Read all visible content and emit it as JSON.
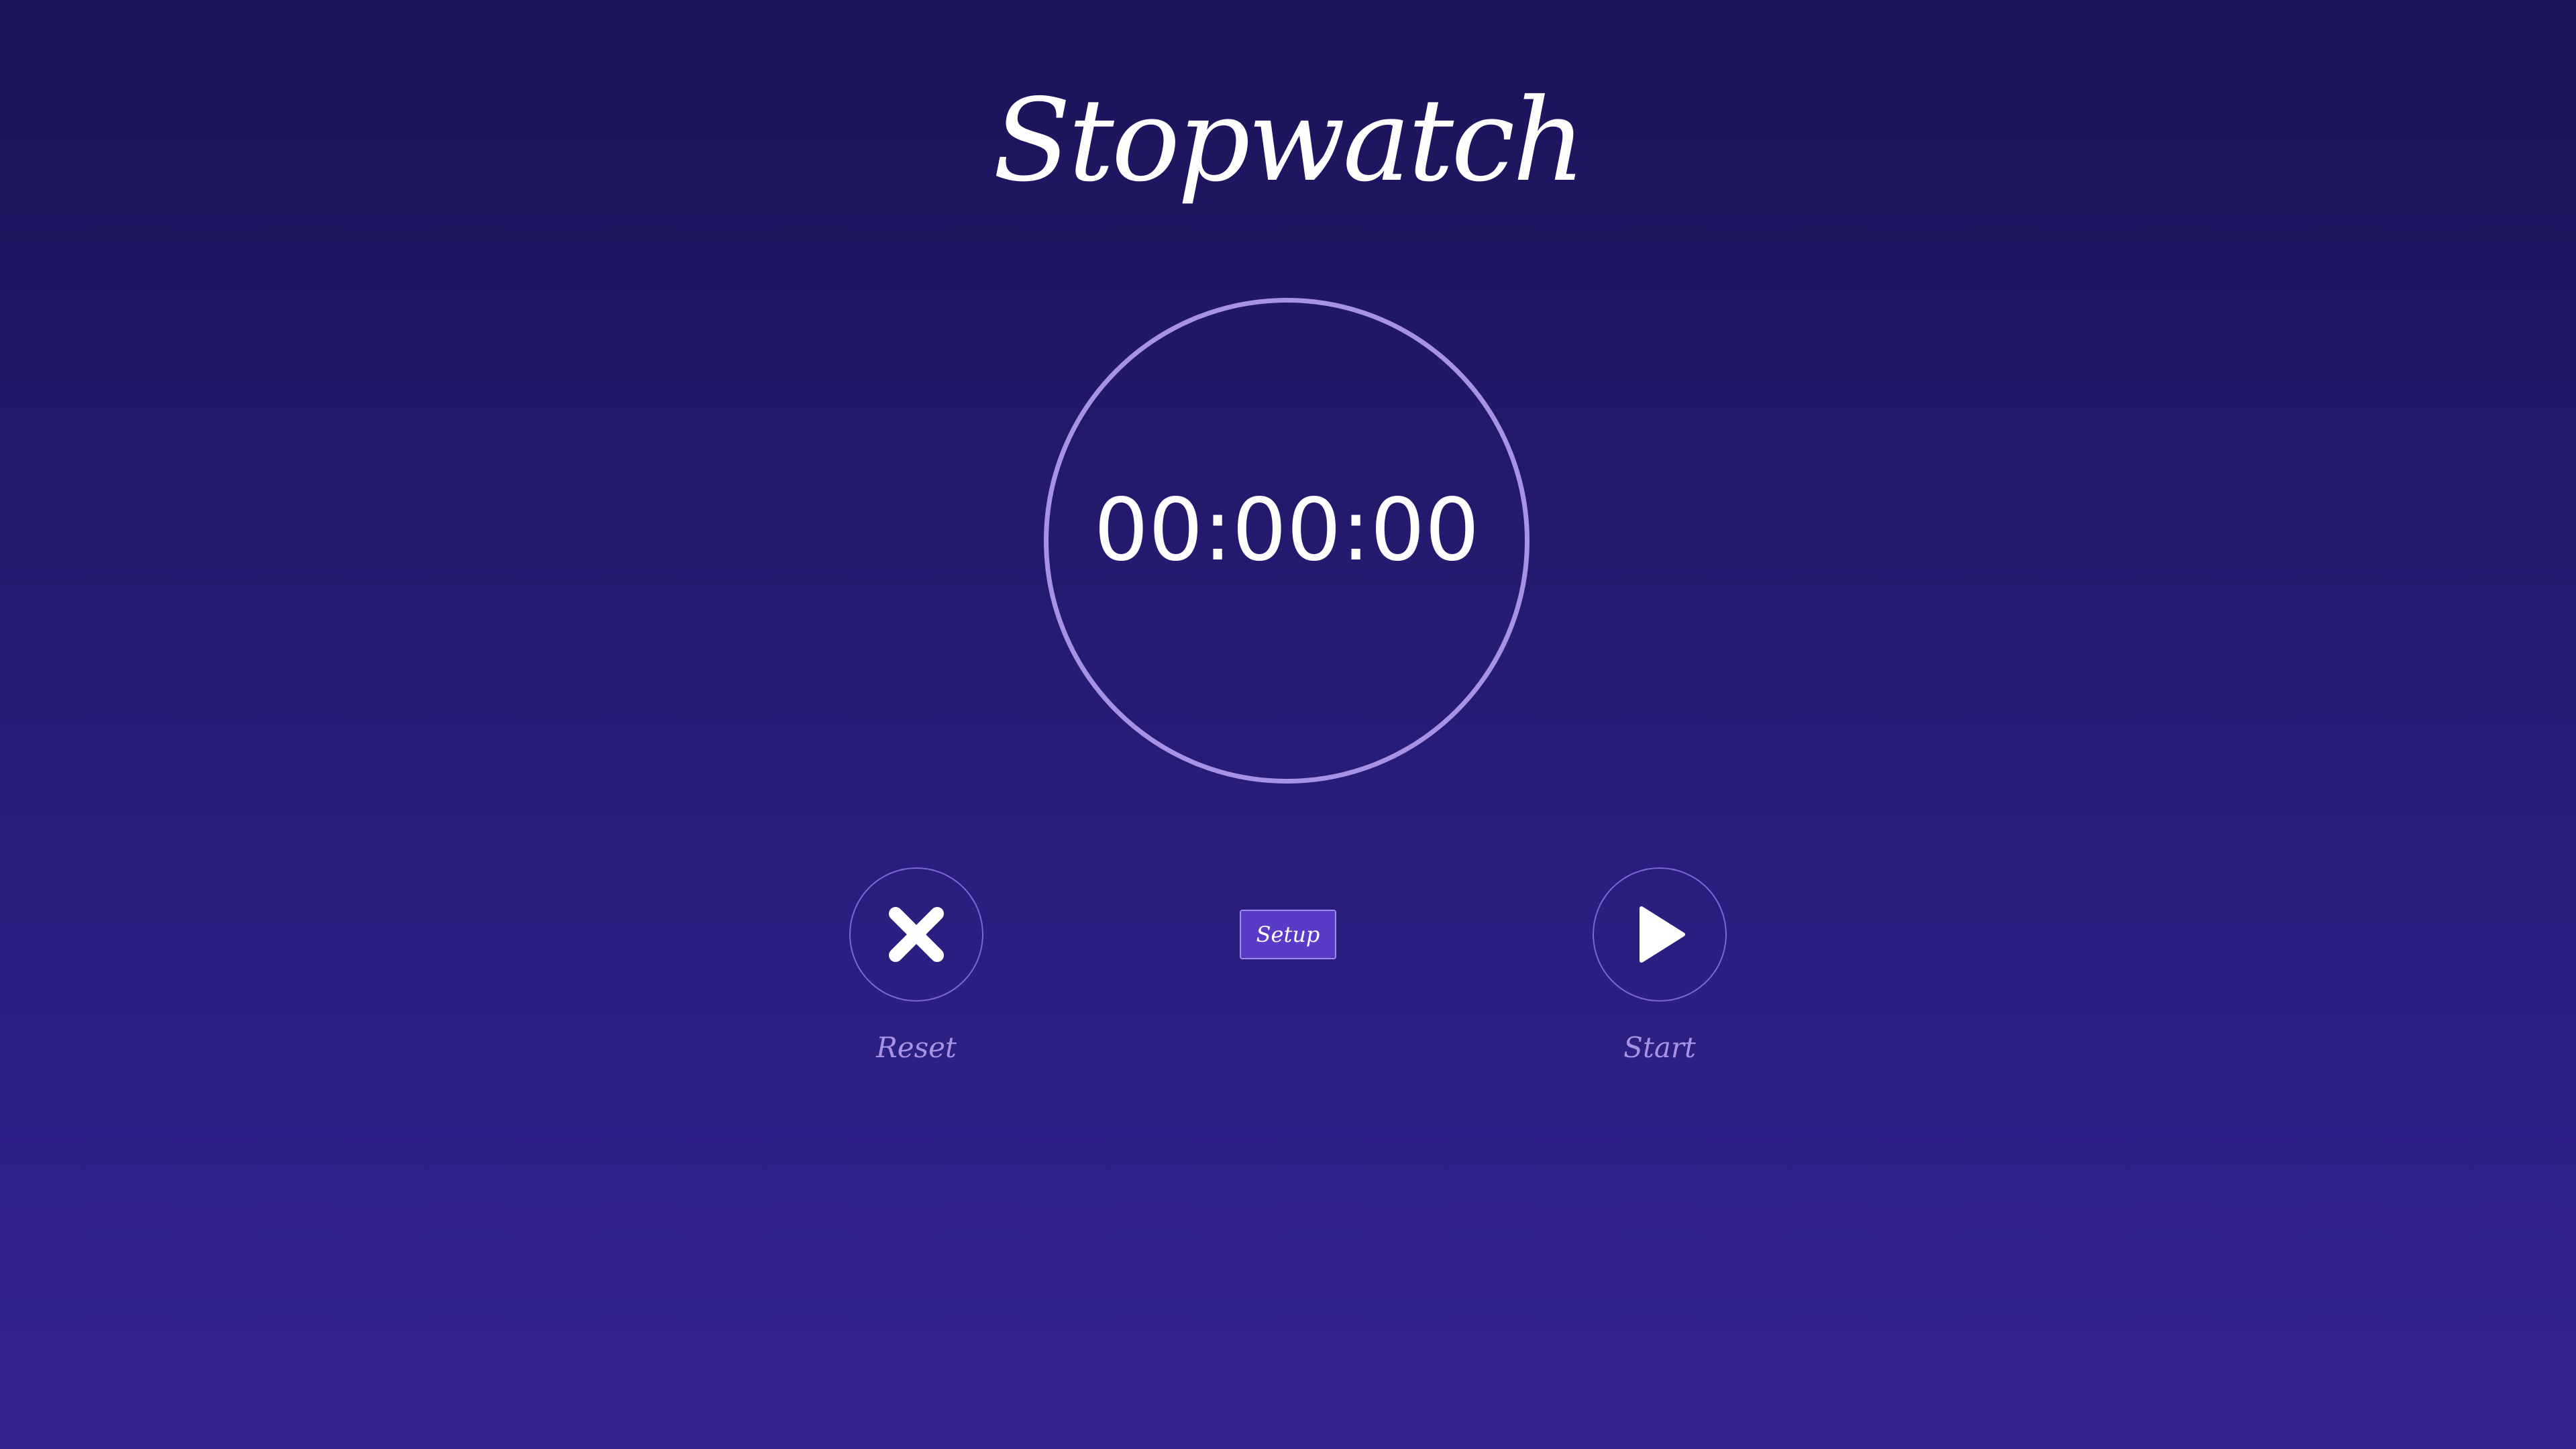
{
  "app": {
    "title": "Stopwatch"
  },
  "timer": {
    "display": "00:00:00"
  },
  "controls": {
    "reset": {
      "label": "Reset",
      "icon": "close-icon"
    },
    "setup": {
      "label": "Setup"
    },
    "start": {
      "label": "Start",
      "icon": "play-icon"
    }
  },
  "colors": {
    "background_top": "#1b1458",
    "background_bottom": "#33238f",
    "dial_ring": "#a892e6",
    "button_border": "#7c68cf",
    "label": "#a892e6",
    "setup_fill": "#5a3bc7",
    "text": "#ffffff"
  }
}
